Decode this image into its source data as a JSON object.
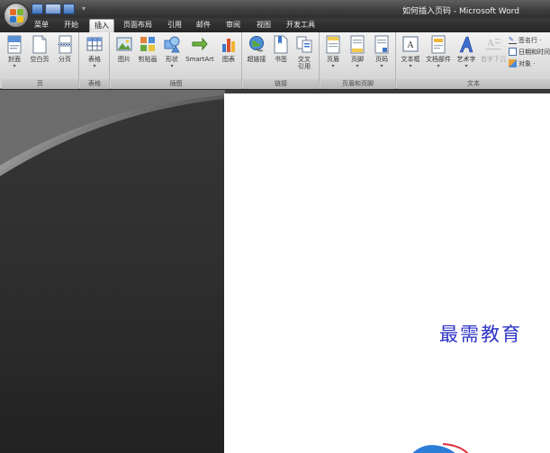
{
  "window": {
    "title": "如何插入页码 - Microsoft Word"
  },
  "tabs": [
    {
      "label": "菜单"
    },
    {
      "label": "开始"
    },
    {
      "label": "插入"
    },
    {
      "label": "页面布局"
    },
    {
      "label": "引用"
    },
    {
      "label": "邮件"
    },
    {
      "label": "审阅"
    },
    {
      "label": "视图"
    },
    {
      "label": "开发工具"
    }
  ],
  "active_tab": "插入",
  "ribbon": {
    "pages": {
      "label": "页",
      "buttons": [
        {
          "label": "封面",
          "icon": "cover-page-icon"
        },
        {
          "label": "空白页",
          "icon": "blank-page-icon"
        },
        {
          "label": "分页",
          "icon": "page-break-icon"
        }
      ]
    },
    "tables": {
      "label": "表格",
      "buttons": [
        {
          "label": "表格",
          "icon": "table-icon"
        }
      ]
    },
    "illustrations": {
      "label": "插图",
      "buttons": [
        {
          "label": "图片",
          "icon": "picture-icon"
        },
        {
          "label": "剪贴画",
          "icon": "clip-art-icon"
        },
        {
          "label": "形状",
          "icon": "shapes-icon"
        },
        {
          "label": "SmartArt",
          "icon": "smartart-icon"
        },
        {
          "label": "图表",
          "icon": "chart-icon"
        }
      ]
    },
    "links": {
      "label": "链接",
      "buttons": [
        {
          "label": "超链接",
          "icon": "hyperlink-icon"
        },
        {
          "label": "书签",
          "icon": "bookmark-icon"
        },
        {
          "label": "交叉",
          "label2": "引用",
          "icon": "cross-reference-icon"
        }
      ]
    },
    "header_footer": {
      "label": "页眉和页脚",
      "buttons": [
        {
          "label": "页眉",
          "icon": "header-icon"
        },
        {
          "label": "页脚",
          "icon": "footer-icon"
        },
        {
          "label": "页码",
          "icon": "page-number-icon"
        }
      ]
    },
    "text": {
      "label": "文本",
      "buttons": [
        {
          "label": "文本框",
          "icon": "text-box-icon"
        },
        {
          "label": "文档部件",
          "icon": "quick-parts-icon"
        },
        {
          "label": "艺术字",
          "icon": "wordart-icon"
        },
        {
          "label": "首字下沉",
          "icon": "drop-cap-icon"
        }
      ],
      "small_buttons": [
        {
          "label": "签名行 ·",
          "icon": "signature-line-icon"
        },
        {
          "label": "日期和时间",
          "icon": "date-time-icon"
        },
        {
          "label": "对象 ·",
          "icon": "object-icon"
        }
      ]
    }
  },
  "watermark": "最需教育",
  "colors": {
    "title_bar": "#3d3d3d",
    "ribbon_bg": "#dadada",
    "workspace_bg": "#2d2d2d",
    "page_bg": "#ffffff",
    "watermark_text": "#2f35c4"
  }
}
